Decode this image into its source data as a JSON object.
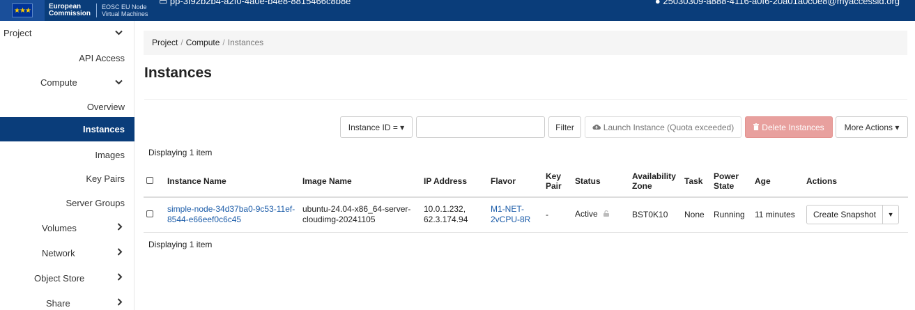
{
  "topbar": {
    "brand_line1": "European",
    "brand_line2": "Commission",
    "service_line1": "EOSC EU Node",
    "service_line2": "Virtual Machines",
    "project_selector": "pp-3f92b2b4-a2f0-4a0e-b4e8-8815466c8b8e",
    "user_menu": "25030309-a888-4116-a0f6-20a01a0c0e8@myaccessid.org",
    "bar_color": "#0a3d7a"
  },
  "sidebar": {
    "items": [
      {
        "label": "Project",
        "chevron": "down"
      },
      {
        "label": "API Access"
      },
      {
        "label": "Compute",
        "chevron": "down"
      },
      {
        "label": "Overview"
      },
      {
        "label": "Instances",
        "active": true
      },
      {
        "label": "Images"
      },
      {
        "label": "Key Pairs"
      },
      {
        "label": "Server Groups"
      },
      {
        "label": "Volumes",
        "chevron": "right"
      },
      {
        "label": "Network",
        "chevron": "right"
      },
      {
        "label": "Object Store",
        "chevron": "right"
      },
      {
        "label": "Share",
        "chevron": "right"
      }
    ],
    "active_color": "#0a3d7a"
  },
  "breadcrumb": [
    "Project",
    "Compute",
    "Instances"
  ],
  "page_title": "Instances",
  "toolbar": {
    "filter_field": "Instance ID = ▾",
    "search_value": "",
    "filter_label": "Filter",
    "launch_label": "Launch Instance (Quota exceeded)",
    "delete_label": "Delete Instances",
    "more_label": "More Actions ▾"
  },
  "display_count_top": "Displaying 1 item",
  "display_count_bottom": "Displaying 1 item",
  "table": {
    "columns": [
      "Instance Name",
      "Image Name",
      "IP Address",
      "Flavor",
      "Key Pair",
      "Status",
      "Availability Zone",
      "Task",
      "Power State",
      "Age",
      "Actions"
    ],
    "rows": [
      {
        "instance_name": "simple-node-34d37ba0-9c53-11ef-8544-e66eef0c6c45",
        "image_name": "ubuntu-24.04-x86_64-server-cloudimg-20241105",
        "ip_address": "10.0.1.232, 62.3.174.94",
        "flavor": "M1-NET-2vCPU-8R",
        "key_pair": "-",
        "status": "Active",
        "availability_zone": "BST0K10",
        "task": "None",
        "power_state": "Running",
        "age": "11 minutes",
        "action": "Create Snapshot"
      }
    ]
  },
  "icons": {
    "cloud_upload": "cloud-upload-icon",
    "trash": "trash-icon",
    "lock": "lock-icon"
  },
  "colors": {
    "link": "#1a5ba8",
    "danger_button": "#e8a09e"
  }
}
